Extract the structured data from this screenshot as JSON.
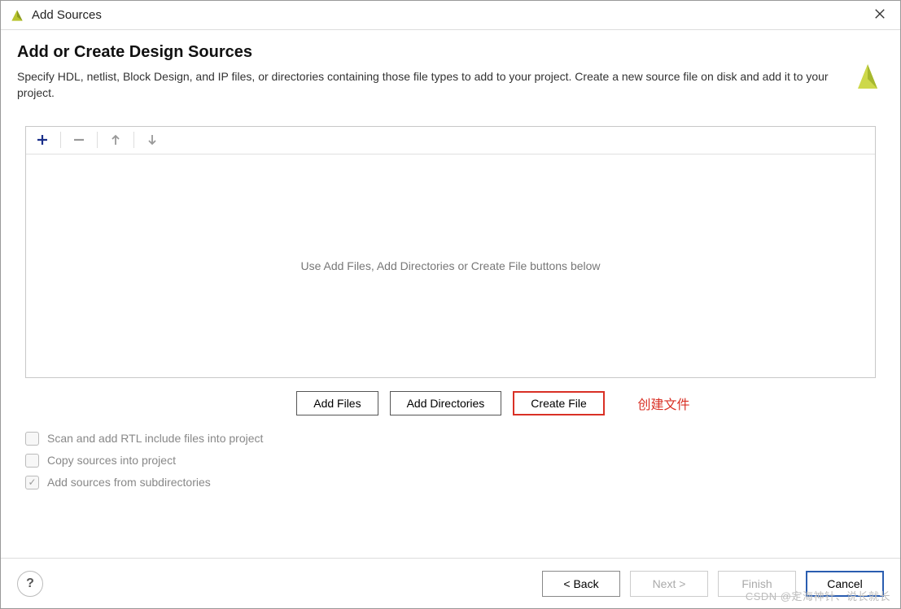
{
  "window": {
    "title": "Add Sources"
  },
  "header": {
    "heading": "Add or Create Design Sources",
    "description": "Specify HDL, netlist, Block Design, and IP files, or directories containing those file types to add to your project. Create a new source file on disk and add it to your project."
  },
  "list": {
    "empty_hint": "Use Add Files, Add Directories or Create File buttons below"
  },
  "actions": {
    "add_files": "Add Files",
    "add_dirs": "Add Directories",
    "create_file": "Create File",
    "annotation": "创建文件"
  },
  "checkboxes": {
    "scan_rtl": {
      "label": "Scan and add RTL include files into project",
      "checked": false
    },
    "copy_sources": {
      "label": "Copy sources into project",
      "checked": false
    },
    "add_subdirs": {
      "label": "Add sources from subdirectories",
      "checked": true
    }
  },
  "footer": {
    "help": "?",
    "back": "< Back",
    "next": "Next >",
    "finish": "Finish",
    "cancel": "Cancel"
  },
  "watermark": "CSDN @定海神针、说长就长"
}
